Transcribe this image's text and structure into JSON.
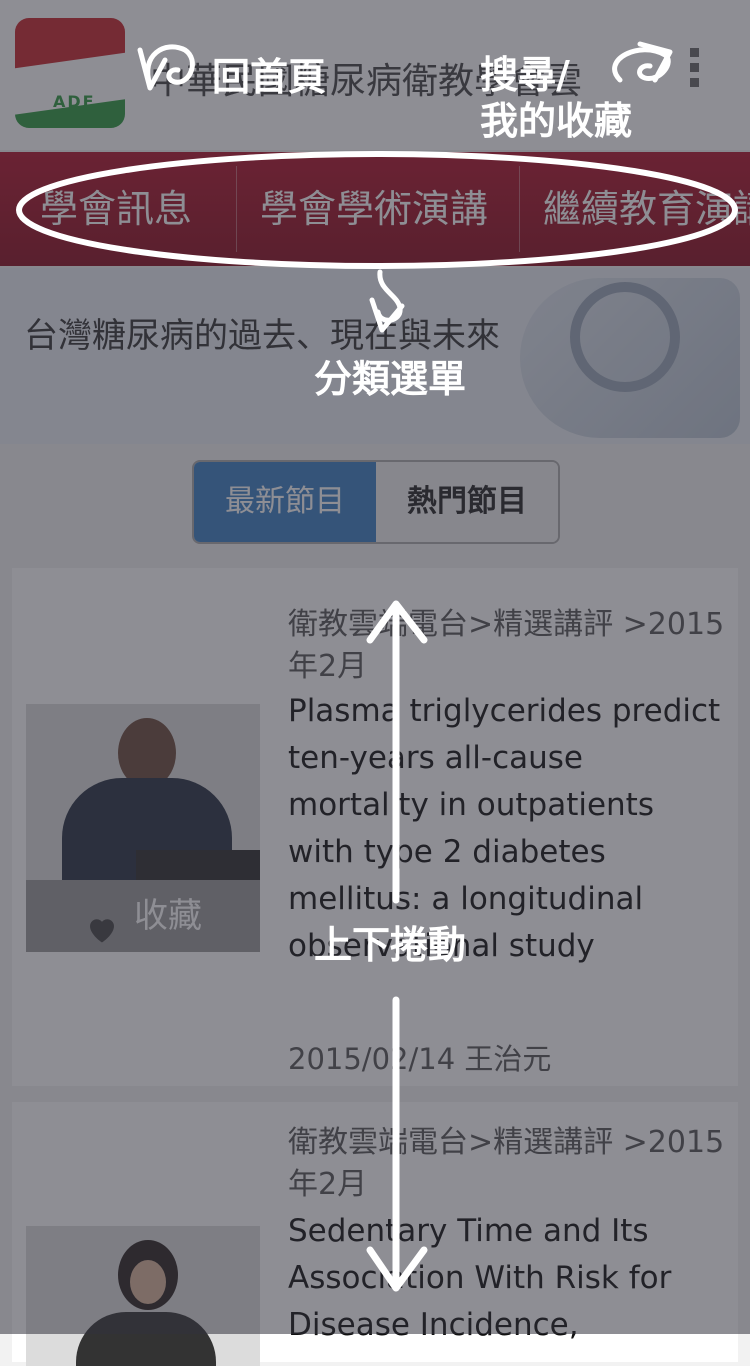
{
  "header": {
    "site_title": "中華民國糖尿病衛教學會雲",
    "logo_text": "ADE"
  },
  "categories": [
    "學會訊息",
    "學會學術演講",
    "繼續教育演講"
  ],
  "banner": {
    "text": "台灣糖尿病的過去、現在與未來"
  },
  "tabs": {
    "latest": "最新節目",
    "hot": "熱門節目"
  },
  "cards": [
    {
      "meta": "衛教雲端電台>精選講評 >2015年2月",
      "title": "Plasma triglycerides predict ten-years all-cause mortality in outpatients with type 2 diabetes mellitus: a longitudinal observational study",
      "date": "2015/02/14 王治元",
      "favorite_label": "收藏"
    },
    {
      "meta": "衛教雲端電台>精選講評 >2015年2月",
      "title": "Sedentary Time and Its Association With Risk for Disease Incidence,"
    }
  ],
  "annotations": {
    "home": "回首頁",
    "search": "搜尋/\n我的收藏",
    "category_menu": "分類選單",
    "scroll": "上下捲動"
  },
  "colors": {
    "nav_red": "#b0122a",
    "active_tab": "#3a7fc4",
    "overlay": "#32323c"
  }
}
